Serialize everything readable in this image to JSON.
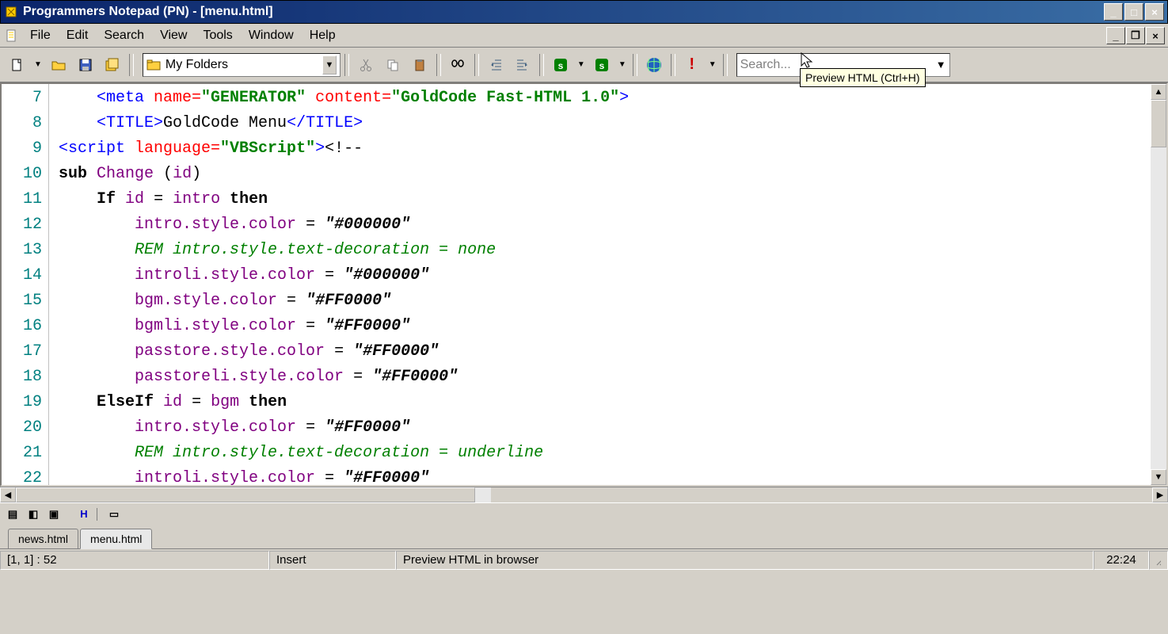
{
  "window": {
    "title": "Programmers Notepad (PN) - [menu.html]"
  },
  "menubar": {
    "items": [
      "File",
      "Edit",
      "Search",
      "View",
      "Tools",
      "Window",
      "Help"
    ]
  },
  "toolbar": {
    "folder_combo": "My Folders",
    "search_placeholder": "Search...",
    "tooltip": "Preview HTML (Ctrl+H)"
  },
  "editor": {
    "first_line": 7,
    "lines": [
      {
        "n": 7,
        "indent": "    ",
        "parts": [
          {
            "c": "c-tag",
            "t": "<meta "
          },
          {
            "c": "c-attr",
            "t": "name="
          },
          {
            "c": "c-str",
            "t": "\"GENERATOR\""
          },
          {
            "c": "c-attr",
            "t": " content="
          },
          {
            "c": "c-str",
            "t": "\"GoldCode Fast-HTML 1.0\""
          },
          {
            "c": "c-tag",
            "t": ">"
          }
        ]
      },
      {
        "n": 8,
        "indent": "    ",
        "parts": [
          {
            "c": "c-tag",
            "t": "<TITLE>"
          },
          {
            "c": "c-punct",
            "t": "GoldCode Menu"
          },
          {
            "c": "c-tag",
            "t": "</TITLE>"
          }
        ]
      },
      {
        "n": 9,
        "indent": "",
        "parts": [
          {
            "c": "c-tag",
            "t": "<script "
          },
          {
            "c": "c-attr",
            "t": "language="
          },
          {
            "c": "c-str",
            "t": "\"VBScript\""
          },
          {
            "c": "c-tag",
            "t": ">"
          },
          {
            "c": "c-punct",
            "t": "<!--"
          }
        ]
      },
      {
        "n": 10,
        "indent": "",
        "parts": [
          {
            "c": "c-kw",
            "t": "sub"
          },
          {
            "c": "c-punct",
            "t": " "
          },
          {
            "c": "c-ident",
            "t": "Change"
          },
          {
            "c": "c-punct",
            "t": " ("
          },
          {
            "c": "c-ident",
            "t": "id"
          },
          {
            "c": "c-punct",
            "t": ")"
          }
        ]
      },
      {
        "n": 11,
        "indent": "    ",
        "parts": [
          {
            "c": "c-kw",
            "t": "If"
          },
          {
            "c": "c-punct",
            "t": " "
          },
          {
            "c": "c-ident",
            "t": "id"
          },
          {
            "c": "c-punct",
            "t": " = "
          },
          {
            "c": "c-ident",
            "t": "intro"
          },
          {
            "c": "c-punct",
            "t": " "
          },
          {
            "c": "c-kw",
            "t": "then"
          }
        ]
      },
      {
        "n": 12,
        "indent": "        ",
        "parts": [
          {
            "c": "c-ident",
            "t": "intro.style.color"
          },
          {
            "c": "c-punct",
            "t": " = "
          },
          {
            "c": "c-strlit",
            "t": "\"#000000\""
          }
        ]
      },
      {
        "n": 13,
        "indent": "        ",
        "parts": [
          {
            "c": "c-comment",
            "t": "REM intro.style.text-decoration = none"
          }
        ]
      },
      {
        "n": 14,
        "indent": "        ",
        "parts": [
          {
            "c": "c-ident",
            "t": "introli.style.color"
          },
          {
            "c": "c-punct",
            "t": " = "
          },
          {
            "c": "c-strlit",
            "t": "\"#000000\""
          }
        ]
      },
      {
        "n": 15,
        "indent": "        ",
        "parts": [
          {
            "c": "c-ident",
            "t": "bgm.style.color"
          },
          {
            "c": "c-punct",
            "t": " = "
          },
          {
            "c": "c-strlit",
            "t": "\"#FF0000\""
          }
        ]
      },
      {
        "n": 16,
        "indent": "        ",
        "parts": [
          {
            "c": "c-ident",
            "t": "bgmli.style.color"
          },
          {
            "c": "c-punct",
            "t": " = "
          },
          {
            "c": "c-strlit",
            "t": "\"#FF0000\""
          }
        ]
      },
      {
        "n": 17,
        "indent": "        ",
        "parts": [
          {
            "c": "c-ident",
            "t": "passtore.style.color"
          },
          {
            "c": "c-punct",
            "t": " = "
          },
          {
            "c": "c-strlit",
            "t": "\"#FF0000\""
          }
        ]
      },
      {
        "n": 18,
        "indent": "        ",
        "parts": [
          {
            "c": "c-ident",
            "t": "passtoreli.style.color"
          },
          {
            "c": "c-punct",
            "t": " = "
          },
          {
            "c": "c-strlit",
            "t": "\"#FF0000\""
          }
        ]
      },
      {
        "n": 19,
        "indent": "    ",
        "parts": [
          {
            "c": "c-kw",
            "t": "ElseIf"
          },
          {
            "c": "c-punct",
            "t": " "
          },
          {
            "c": "c-ident",
            "t": "id"
          },
          {
            "c": "c-punct",
            "t": " = "
          },
          {
            "c": "c-ident",
            "t": "bgm"
          },
          {
            "c": "c-punct",
            "t": " "
          },
          {
            "c": "c-kw",
            "t": "then"
          }
        ]
      },
      {
        "n": 20,
        "indent": "        ",
        "parts": [
          {
            "c": "c-ident",
            "t": "intro.style.color"
          },
          {
            "c": "c-punct",
            "t": " = "
          },
          {
            "c": "c-strlit",
            "t": "\"#FF0000\""
          }
        ]
      },
      {
        "n": 21,
        "indent": "        ",
        "parts": [
          {
            "c": "c-comment",
            "t": "REM intro.style.text-decoration = underline"
          }
        ]
      },
      {
        "n": 22,
        "indent": "        ",
        "parts": [
          {
            "c": "c-ident",
            "t": "introli.style.color"
          },
          {
            "c": "c-punct",
            "t": " = "
          },
          {
            "c": "c-strlit",
            "t": "\"#FF0000\""
          }
        ]
      }
    ]
  },
  "tabs": [
    "news.html",
    "menu.html"
  ],
  "active_tab": 1,
  "statusbar": {
    "pos": "[1, 1] : 52",
    "mode": "Insert",
    "hint": "Preview HTML in browser",
    "time": "22:24"
  }
}
